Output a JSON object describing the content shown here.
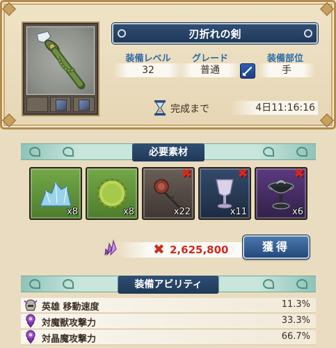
{
  "item": {
    "name": "刃折れの剣",
    "portrait_icon": "broken-sword-icon"
  },
  "stats": {
    "level_label": "装備レベル",
    "level_value": "32",
    "grade_label": "グレード",
    "grade_value": "普通",
    "slot_label": "装備部位",
    "slot_value": "手",
    "slot_icon": "sword-slot-icon"
  },
  "craft": {
    "complete_label": "完成まで",
    "complete_time": "4日11:16:16"
  },
  "materials_section": {
    "title": "必要素材",
    "items": [
      {
        "icon": "blue-crystal-ore-icon",
        "count": "x8",
        "missing": false
      },
      {
        "icon": "green-vine-wreath-icon",
        "count": "x8",
        "missing": false
      },
      {
        "icon": "withered-rose-icon",
        "count": "x22",
        "missing": true
      },
      {
        "icon": "crystal-goblet-icon",
        "count": "x11",
        "missing": true
      },
      {
        "icon": "dark-chalice-icon",
        "count": "x6",
        "missing": true
      }
    ],
    "missing_mark": "✖"
  },
  "cost": {
    "icon": "purple-crystal-icon",
    "mark": "✖",
    "value": "2,625,800",
    "acquire_button": "獲得"
  },
  "abilities_section": {
    "title": "装備アビリティ",
    "items": [
      {
        "icon": "hero-helmet-icon",
        "name": "英雄 移動速度",
        "value": "11.3%"
      },
      {
        "icon": "purple-rank-icon",
        "name": "対魔獣攻撃力",
        "value": "33.3%"
      },
      {
        "icon": "purple-rank-icon",
        "name": "対晶魔攻撃力",
        "value": "66.7%"
      }
    ]
  },
  "colors": {
    "banner_blue": "#1f3857",
    "label_blue": "#2d6aa6",
    "cost_red": "#d3281f",
    "parchment": "#e9dcc0"
  }
}
